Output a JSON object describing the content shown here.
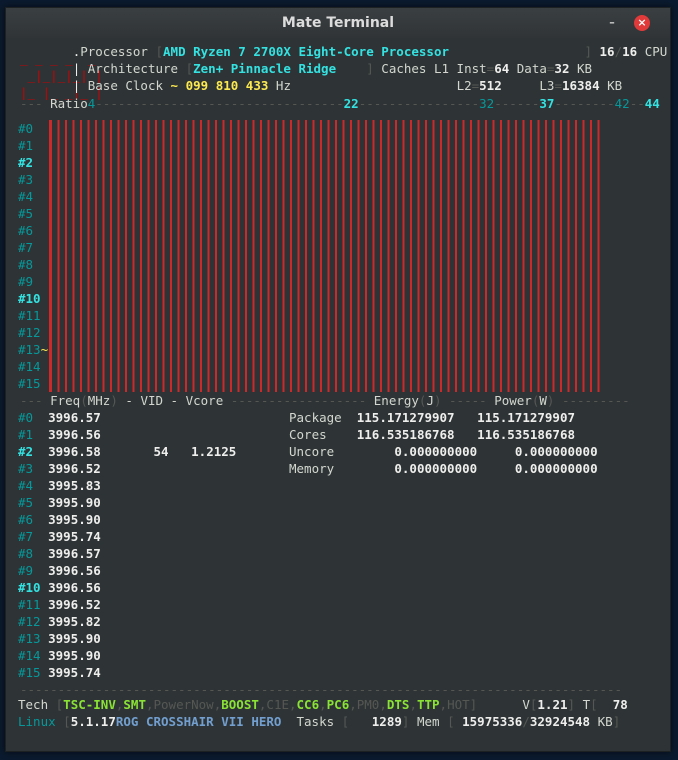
{
  "window": {
    "title": "Mate Terminal",
    "minimize": "–",
    "maximize": "▫",
    "close": "×"
  },
  "header": {
    "processor_label": "Processor",
    "processor_name": "AMD Ryzen 7 2700X Eight-Core Processor",
    "threads_active": "16",
    "threads_total": "16",
    "cpu_label": "CPU",
    "architecture_label": "Architecture",
    "architecture": "Zen+ Pinnacle Ridge",
    "caches_label": "Caches L1 Inst",
    "l1_inst": "64",
    "data_label": "Data",
    "l1_data": "32",
    "kb1": "KB",
    "base_clock_label": "Base Clock",
    "base_clock_value": "~ 099 810 433",
    "hz": "Hz",
    "l2_label": "L2",
    "l2_value": "512",
    "l3_label": "L3",
    "l3_value": "16384",
    "kb2": "KB"
  },
  "ratio_ruler": {
    "label": "Ratio",
    "marks": [
      "4",
      "22",
      "32",
      "37",
      "42",
      "44"
    ]
  },
  "cores": [
    "#0",
    "#1",
    "#2",
    "#3",
    "#4",
    "#5",
    "#6",
    "#7",
    "#8",
    "#9",
    "#10",
    "#11",
    "#12",
    "#13",
    "#14",
    "#15"
  ],
  "current_core_marker": "~",
  "columns": {
    "freq": "Freq",
    "freq_unit": "MHz",
    "vid": "VID",
    "vcore": "Vcore",
    "energy": "Energy",
    "energy_unit": "J",
    "power": "Power",
    "power_unit": "W"
  },
  "frequencies": [
    "3996.57",
    "3996.56",
    "3996.58",
    "3996.52",
    "3995.83",
    "3995.90",
    "3995.90",
    "3995.74",
    "3996.57",
    "3996.56",
    "3996.56",
    "3996.52",
    "3995.82",
    "3995.90",
    "3995.90",
    "3995.74"
  ],
  "voltage": {
    "vid": "54",
    "vcore": "1.2125"
  },
  "energy": [
    {
      "name": "Package",
      "energy": "115.171279907",
      "power": "115.171279907"
    },
    {
      "name": "Cores",
      "energy": "116.535186768",
      "power": "116.535186768"
    },
    {
      "name": "Uncore",
      "energy": "0.000000000",
      "power": "0.000000000"
    },
    {
      "name": "Memory",
      "energy": "0.000000000",
      "power": "0.000000000"
    }
  ],
  "tech": {
    "label": "Tech",
    "flags": [
      "TSC-INV",
      "SMT",
      "PowerNow",
      "BOOST",
      "C1E",
      "CC6",
      "PC6",
      "PM0",
      "DTS",
      "TTP",
      "HOT"
    ],
    "v_label": "V",
    "v_value": "1.21",
    "t_label": "T",
    "t_value": "78"
  },
  "system": {
    "os": "Linux",
    "kernel": "5.1.17",
    "board": "ROG CROSSHAIR VII HERO",
    "tasks_label": "Tasks",
    "tasks": "1289",
    "mem_label": "Mem",
    "mem_used": "15975336",
    "mem_total": "32924548",
    "mem_unit": "KB"
  },
  "colors": {
    "terminal_bg": "#2e3436",
    "bars": "#cc2a2a",
    "accent_cyan": "#34e2e2",
    "yellow": "#fce94f",
    "green": "#8ae234"
  }
}
